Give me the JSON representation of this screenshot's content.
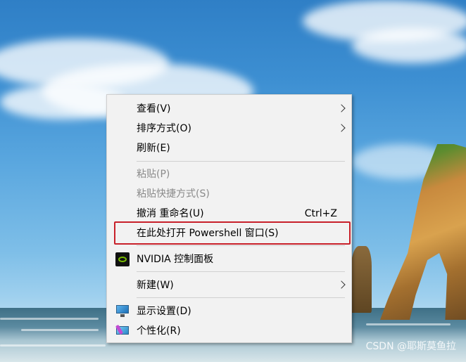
{
  "menu": {
    "items": [
      {
        "label": "查看(V)",
        "submenu": true,
        "disabled": false
      },
      {
        "label": "排序方式(O)",
        "submenu": true,
        "disabled": false
      },
      {
        "label": "刷新(E)",
        "submenu": false,
        "disabled": false
      },
      {
        "label": "粘贴(P)",
        "submenu": false,
        "disabled": true
      },
      {
        "label": "粘贴快捷方式(S)",
        "submenu": false,
        "disabled": true
      },
      {
        "label": "撤消 重命名(U)",
        "shortcut": "Ctrl+Z",
        "submenu": false,
        "disabled": false
      },
      {
        "label": "在此处打开 Powershell 窗口(S)",
        "submenu": false,
        "disabled": false,
        "highlighted": true
      },
      {
        "label": "NVIDIA 控制面板",
        "icon": "nvidia-icon",
        "submenu": false,
        "disabled": false
      },
      {
        "label": "新建(W)",
        "submenu": true,
        "disabled": false
      },
      {
        "label": "显示设置(D)",
        "icon": "display-settings-icon",
        "submenu": false,
        "disabled": false
      },
      {
        "label": "个性化(R)",
        "icon": "personalize-icon",
        "submenu": false,
        "disabled": false
      }
    ]
  },
  "highlight_color": "#c8202a",
  "watermark": "CSDN @耶斯莫鱼拉"
}
